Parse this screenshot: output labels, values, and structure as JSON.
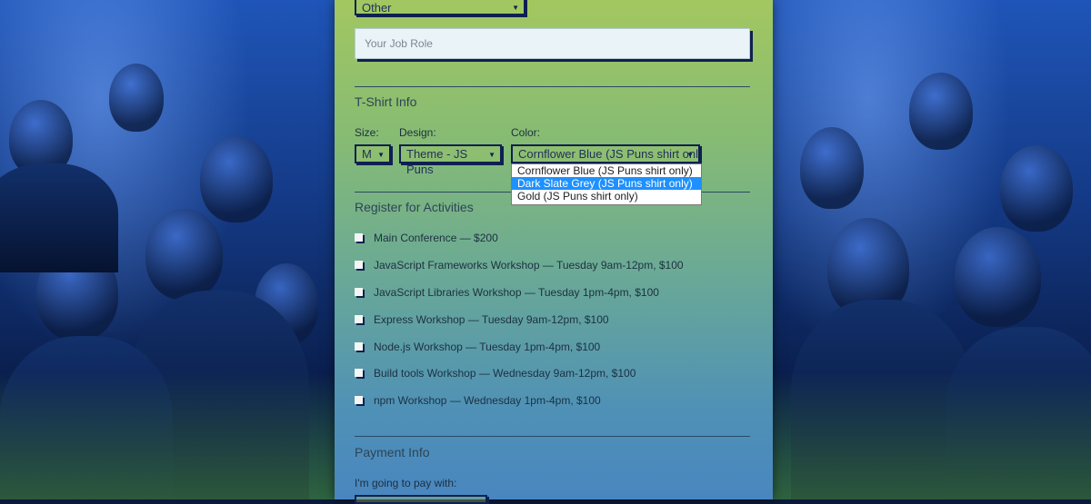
{
  "job": {
    "title_selected": "Other",
    "role_placeholder": "Your Job Role"
  },
  "tshirt": {
    "heading": "T-Shirt Info",
    "size_label": "Size:",
    "size_value": "M",
    "design_label": "Design:",
    "design_value": "Theme - JS Puns",
    "color_label": "Color:",
    "color_value": "Cornflower Blue (JS Puns shirt only)",
    "color_options": [
      "Cornflower Blue (JS Puns shirt only)",
      "Dark Slate Grey (JS Puns shirt only)",
      "Gold (JS Puns shirt only)"
    ],
    "highlighted_option_index": 1
  },
  "activities": {
    "heading": "Register for Activities",
    "items": [
      "Main Conference — $200",
      "JavaScript Frameworks Workshop — Tuesday 9am-12pm, $100",
      "JavaScript Libraries Workshop — Tuesday 1pm-4pm, $100",
      "Express Workshop — Tuesday 9am-12pm, $100",
      "Node.js Workshop — Tuesday 1pm-4pm, $100",
      "Build tools Workshop — Wednesday 9am-12pm, $100",
      "npm Workshop — Wednesday 1pm-4pm, $100"
    ]
  },
  "payment": {
    "heading": "Payment Info",
    "pay_label": "I'm going to pay with:"
  },
  "icons": {
    "select_arrow": "triangle-down-icon",
    "checkbox": "checkbox-icon"
  }
}
